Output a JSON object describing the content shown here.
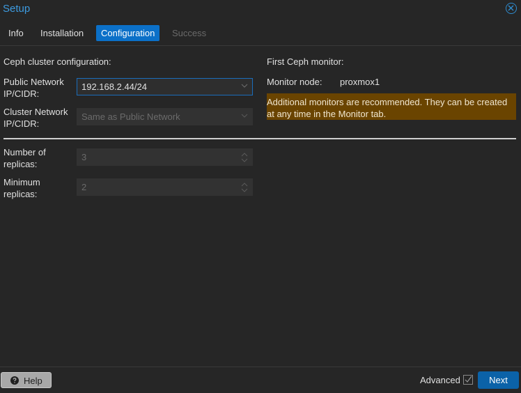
{
  "window": {
    "title": "Setup",
    "close_icon": "close-circle-icon"
  },
  "tabs": [
    {
      "label": "Info",
      "state": "normal"
    },
    {
      "label": "Installation",
      "state": "normal"
    },
    {
      "label": "Configuration",
      "state": "active"
    },
    {
      "label": "Success",
      "state": "disabled"
    }
  ],
  "left": {
    "section_title": "Ceph cluster configuration:",
    "public_network": {
      "label_line1": "Public Network",
      "label_line2": "IP/CIDR:",
      "value": "192.168.2.44/24"
    },
    "cluster_network": {
      "label_line1": "Cluster Network",
      "label_line2": "IP/CIDR:",
      "value": "Same as Public Network"
    },
    "replicas": {
      "label_line1": "Number of",
      "label_line2": "replicas:",
      "value": "3"
    },
    "min_replicas": {
      "label_line1": "Minimum",
      "label_line2": "replicas:",
      "value": "2"
    }
  },
  "right": {
    "section_title": "First Ceph monitor:",
    "monitor_node_label": "Monitor node:",
    "monitor_node_value": "proxmox1",
    "warning_line1": "Additional monitors are recommended. They can be created",
    "warning_line2": "at any time in the Monitor tab."
  },
  "footer": {
    "help_label": "Help",
    "help_icon": "question-circle-icon",
    "advanced_label": "Advanced",
    "advanced_checked": true,
    "next_label": "Next"
  },
  "colors": {
    "accent": "#0b70c8",
    "warning_bg": "#6a4400",
    "title": "#3d9be0"
  }
}
